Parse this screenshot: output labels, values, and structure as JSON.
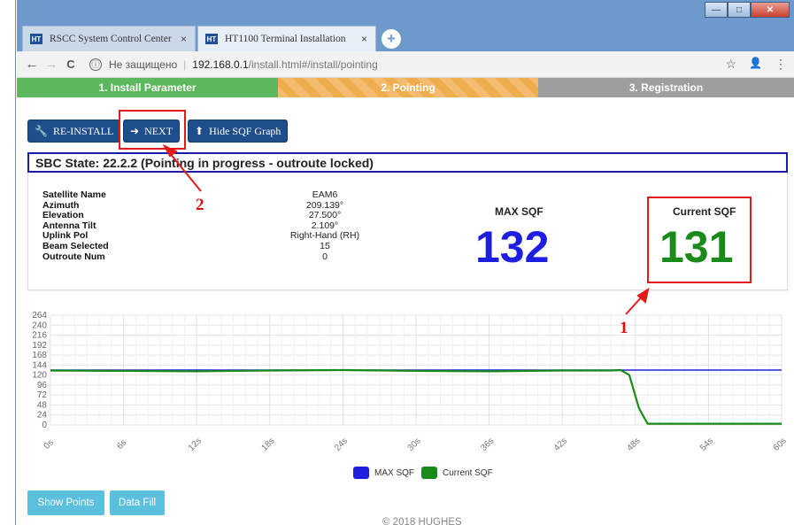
{
  "browser": {
    "tabs": [
      {
        "favicon": "HT",
        "label": "RSCC System Control Center",
        "close": "×"
      },
      {
        "favicon": "HT",
        "label": "HT1100 Terminal Installation",
        "close": "×"
      }
    ],
    "new_tab": "+",
    "window_buttons": {
      "minimize": "—",
      "maximize": "□",
      "close": "✕"
    },
    "nav": {
      "back": "←",
      "forward": "→",
      "reload": "C"
    },
    "address": {
      "security_icon": "ⓘ",
      "security_text": "Не защищено",
      "separator": "|",
      "host": "192.168.0.1",
      "path": "/install.html#/install/pointing"
    },
    "toolbar_icons": {
      "star": "☆",
      "profile": "👤",
      "menu": "⋮"
    }
  },
  "steps": [
    {
      "label": "1. Install Parameter",
      "state": "done"
    },
    {
      "label": "2. Pointing",
      "state": "active"
    },
    {
      "label": "3. Registration",
      "state": "pending"
    }
  ],
  "buttons": {
    "reinstall": {
      "icon": "wrench-icon",
      "label": "RE-INSTALL"
    },
    "next": {
      "icon": "arrow-right-icon",
      "label": "NEXT"
    },
    "hide_graph": {
      "icon": "arrow-up-icon",
      "label": "Hide SQF Graph"
    }
  },
  "sbc_state": "SBC State: 22.2.2 (Pointing in progress - outroute locked)",
  "satellite_info": [
    {
      "label": "Satellite Name",
      "value": "EAM6"
    },
    {
      "label": "Azimuth",
      "value": "209.139°"
    },
    {
      "label": "Elevation",
      "value": "27.500°"
    },
    {
      "label": "Antenna Tilt",
      "value": "2.109°"
    },
    {
      "label": "Uplink Pol",
      "value": "Right-Hand (RH)"
    },
    {
      "label": "Beam Selected",
      "value": "15"
    },
    {
      "label": "Outroute Num",
      "value": "0"
    }
  ],
  "sqf": {
    "max_label": "MAX SQF",
    "max_value": "132",
    "current_label": "Current SQF",
    "current_value": "131"
  },
  "annotations": {
    "one": "1",
    "two": "2"
  },
  "colors": {
    "max_sqf": "#1e1ee0",
    "current_sqf": "#1a8a1a",
    "annotation": "#e21a1a",
    "step_done": "#5cb85c",
    "step_active": "#f0ad4e",
    "step_pending": "#9e9e9e"
  },
  "chart_data": {
    "type": "line",
    "x": [
      "0s",
      "6s",
      "12s",
      "18s",
      "24s",
      "30s",
      "36s",
      "42s",
      "48s",
      "54s",
      "60s"
    ],
    "yticks": [
      0,
      24,
      48,
      72,
      96,
      120,
      144,
      168,
      192,
      216,
      240,
      264
    ],
    "ylim": [
      0,
      264
    ],
    "xlim": [
      0,
      60
    ],
    "grid": true,
    "legend": "bottom",
    "series": [
      {
        "name": "MAX SQF",
        "color": "#1e1ee0",
        "points": [
          [
            0,
            132
          ],
          [
            60,
            132
          ]
        ]
      },
      {
        "name": "Current SQF",
        "color": "#1a8a1a",
        "points": [
          [
            0,
            131
          ],
          [
            6,
            130
          ],
          [
            12,
            129
          ],
          [
            18,
            131
          ],
          [
            24,
            132
          ],
          [
            30,
            130
          ],
          [
            36,
            129
          ],
          [
            42,
            131
          ],
          [
            46,
            131
          ],
          [
            46.8,
            132
          ],
          [
            47.5,
            120
          ],
          [
            48.3,
            40
          ],
          [
            49,
            3
          ],
          [
            52,
            3
          ],
          [
            60,
            3
          ]
        ]
      }
    ]
  },
  "lower_buttons": {
    "show_points": "Show Points",
    "data_fill": "Data Fill"
  },
  "footer": "© 2018 HUGHES"
}
